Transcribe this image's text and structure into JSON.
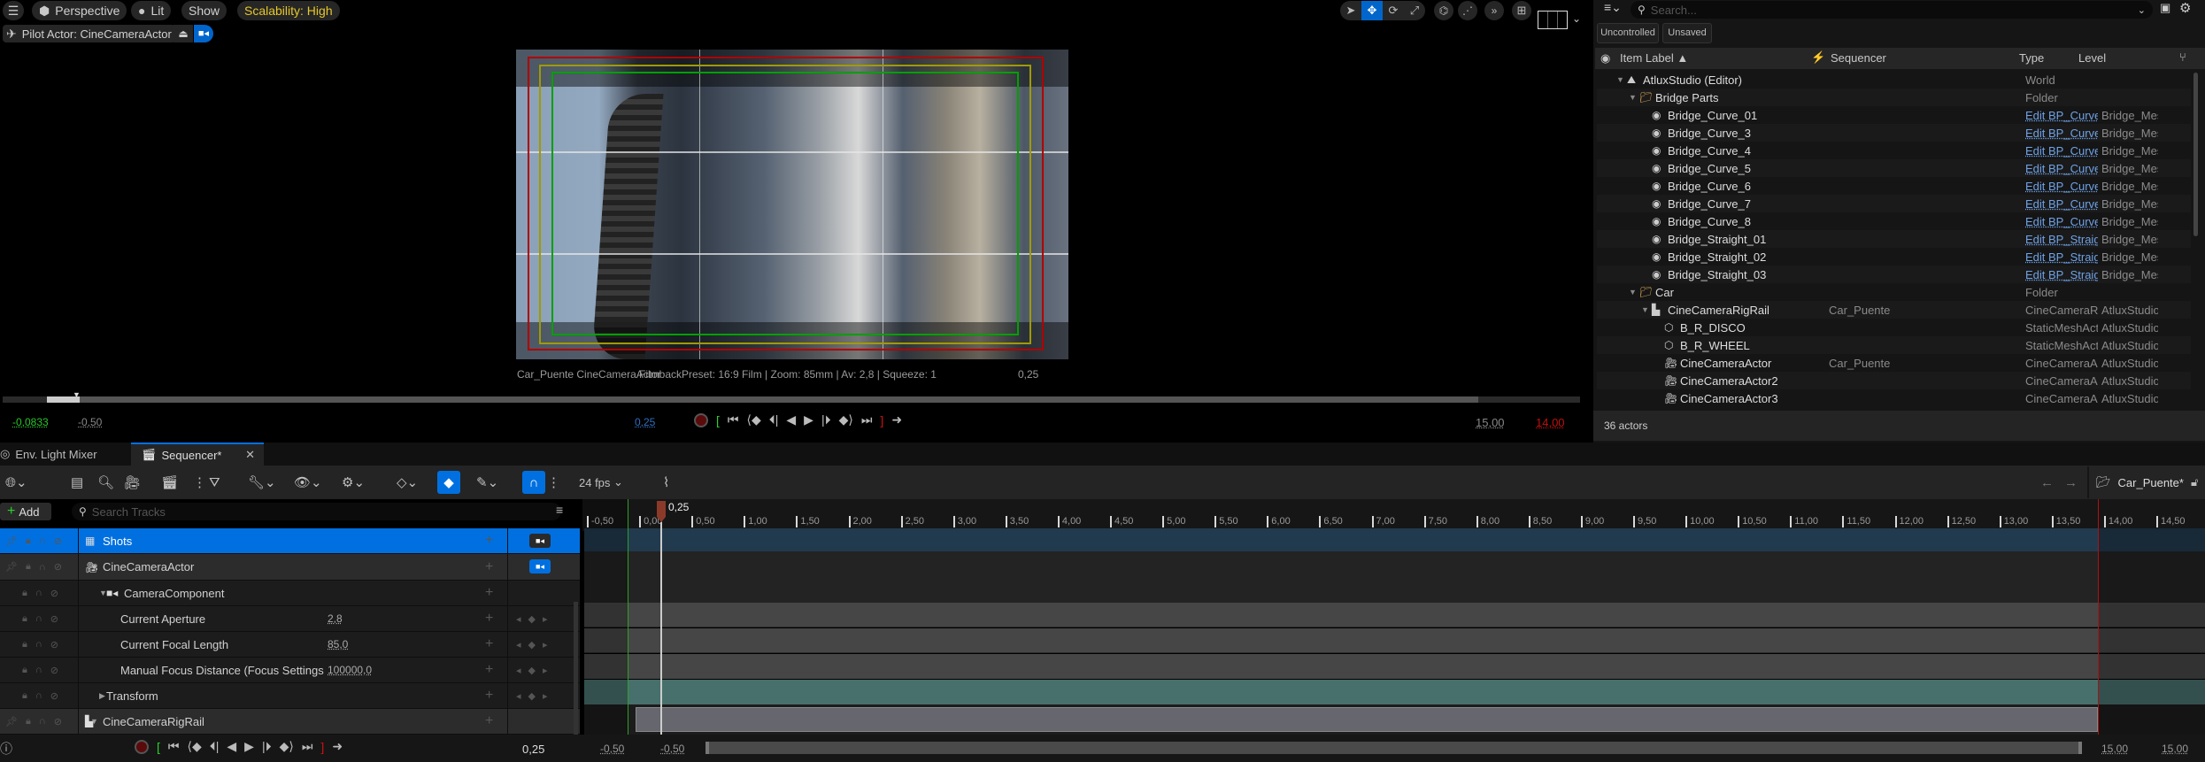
{
  "viewport": {
    "toolbar": {
      "menu_icon": "hamburger-icon",
      "perspective_label": "Perspective",
      "lit_label": "Lit",
      "show_label": "Show",
      "scalability_label": "Scalability: High",
      "pilot_label": "Pilot Actor: CineCameraActor"
    },
    "transform_tools": [
      "select-arrow-icon",
      "translate-icon",
      "rotate-icon",
      "scale-icon",
      "local-space-icon",
      "snap-icon",
      "more-icon",
      "layout-icon"
    ],
    "overlay_left": "Car_Puente  CineCameraActor",
    "overlay_center": "FilmbackPreset: 16:9 Film | Zoom: 85mm | Av: 2,8 | Squeeze: 1",
    "overlay_time": "0,25",
    "playback": {
      "start_time": "-0,0833",
      "view_start": "-0,50",
      "current_time": "0,25",
      "view_end": "15,00",
      "end_time": "14,00"
    }
  },
  "outliner": {
    "search_placeholder": "Search...",
    "filters": [
      "Uncontrolled",
      "Unsaved"
    ],
    "columns": {
      "label": "Item Label ▲",
      "sequencer": "Sequencer",
      "type": "Type",
      "level": "Level"
    },
    "rows": [
      {
        "indent": 1,
        "expander": "▼",
        "icon": "world-icon",
        "label": "AtluxStudio (Editor)",
        "sequencer": "",
        "type": "World",
        "type_link": false,
        "level": ""
      },
      {
        "indent": 2,
        "expander": "▼",
        "icon": "folder-icon",
        "label": "Bridge Parts",
        "sequencer": "",
        "type": "Folder",
        "type_link": false,
        "level": ""
      },
      {
        "indent": 3,
        "expander": "",
        "icon": "actor-icon",
        "label": "Bridge_Curve_01",
        "sequencer": "",
        "type": "Edit BP_Curve",
        "type_link": true,
        "level": "Bridge_Meshes"
      },
      {
        "indent": 3,
        "expander": "",
        "icon": "actor-icon",
        "label": "Bridge_Curve_3",
        "sequencer": "",
        "type": "Edit BP_Curve",
        "type_link": true,
        "level": "Bridge_Meshes"
      },
      {
        "indent": 3,
        "expander": "",
        "icon": "actor-icon",
        "label": "Bridge_Curve_4",
        "sequencer": "",
        "type": "Edit BP_Curve",
        "type_link": true,
        "level": "Bridge_Meshes"
      },
      {
        "indent": 3,
        "expander": "",
        "icon": "actor-icon",
        "label": "Bridge_Curve_5",
        "sequencer": "",
        "type": "Edit BP_Curve",
        "type_link": true,
        "level": "Bridge_Meshes"
      },
      {
        "indent": 3,
        "expander": "",
        "icon": "actor-icon",
        "label": "Bridge_Curve_6",
        "sequencer": "",
        "type": "Edit BP_Curve",
        "type_link": true,
        "level": "Bridge_Meshes"
      },
      {
        "indent": 3,
        "expander": "",
        "icon": "actor-icon",
        "label": "Bridge_Curve_7",
        "sequencer": "",
        "type": "Edit BP_Curve",
        "type_link": true,
        "level": "Bridge_Meshes"
      },
      {
        "indent": 3,
        "expander": "",
        "icon": "actor-icon",
        "label": "Bridge_Curve_8",
        "sequencer": "",
        "type": "Edit BP_Curve",
        "type_link": true,
        "level": "Bridge_Meshes"
      },
      {
        "indent": 3,
        "expander": "",
        "icon": "actor-icon",
        "label": "Bridge_Straight_01",
        "sequencer": "",
        "type": "Edit BP_Straight",
        "type_link": true,
        "level": "Bridge_Meshes"
      },
      {
        "indent": 3,
        "expander": "",
        "icon": "actor-icon",
        "label": "Bridge_Straight_02",
        "sequencer": "",
        "type": "Edit BP_Straight",
        "type_link": true,
        "level": "Bridge_Meshes"
      },
      {
        "indent": 3,
        "expander": "",
        "icon": "actor-icon",
        "label": "Bridge_Straight_03",
        "sequencer": "",
        "type": "Edit BP_Straight",
        "type_link": true,
        "level": "Bridge_Meshes"
      },
      {
        "indent": 2,
        "expander": "▼",
        "icon": "folder-icon",
        "label": "Car",
        "sequencer": "",
        "type": "Folder",
        "type_link": false,
        "level": ""
      },
      {
        "indent": 3,
        "expander": "▼",
        "icon": "rig-rail-icon",
        "label": "CineCameraRigRail",
        "sequencer": "Car_Puente",
        "type": "CineCameraRigRail",
        "type_link": false,
        "level": "AtluxStudio"
      },
      {
        "indent": 4,
        "expander": "",
        "icon": "static-mesh-icon",
        "label": "B_R_DISCO",
        "sequencer": "",
        "type": "StaticMeshActor",
        "type_link": false,
        "level": "AtluxStudio"
      },
      {
        "indent": 4,
        "expander": "",
        "icon": "static-mesh-icon",
        "label": "B_R_WHEEL",
        "sequencer": "",
        "type": "StaticMeshActor",
        "type_link": false,
        "level": "AtluxStudio"
      },
      {
        "indent": 4,
        "expander": "",
        "icon": "cine-camera-icon",
        "label": "CineCameraActor",
        "sequencer": "Car_Puente",
        "type": "CineCameraActor",
        "type_link": false,
        "level": "AtluxStudio"
      },
      {
        "indent": 4,
        "expander": "",
        "icon": "cine-camera-icon",
        "label": "CineCameraActor2",
        "sequencer": "",
        "type": "CineCameraActor",
        "type_link": false,
        "level": "AtluxStudio"
      },
      {
        "indent": 4,
        "expander": "",
        "icon": "cine-camera-icon",
        "label": "CineCameraActor3",
        "sequencer": "",
        "type": "CineCameraActor",
        "type_link": false,
        "level": "AtluxStudio"
      }
    ],
    "actor_count": "36 actors"
  },
  "tabs": [
    {
      "label": "Env. Light Mixer",
      "active": false
    },
    {
      "label": "Sequencer*",
      "active": true
    }
  ],
  "sequencer": {
    "fps": "24 fps",
    "add_label": "Add",
    "search_placeholder": "Search Tracks",
    "sequence_name": "Car_Puente*",
    "playhead_time": "0,25",
    "tracks": [
      {
        "name": "Shots",
        "indent": 0,
        "expander": "",
        "icon": "shots-icon",
        "value": "",
        "selected": true,
        "camera_toggle": "dark",
        "keys": false
      },
      {
        "name": "CineCameraActor",
        "indent": 0,
        "expander": "▼",
        "icon": "cine-camera-icon",
        "value": "",
        "selected": false,
        "camera_toggle": "blue",
        "keys": false
      },
      {
        "name": "CameraComponent",
        "indent": 1,
        "expander": "▼",
        "icon": "camera-component-icon",
        "value": "",
        "selected": false,
        "camera_toggle": "",
        "keys": false
      },
      {
        "name": "Current Aperture",
        "indent": 2,
        "expander": "",
        "icon": "",
        "value": "2,8",
        "selected": false,
        "camera_toggle": "",
        "keys": true
      },
      {
        "name": "Current Focal Length",
        "indent": 2,
        "expander": "",
        "icon": "",
        "value": "85,0",
        "selected": false,
        "camera_toggle": "",
        "keys": true
      },
      {
        "name": "Manual Focus Distance (Focus Settings",
        "indent": 2,
        "expander": "",
        "icon": "",
        "value": "100000,0",
        "selected": false,
        "camera_toggle": "",
        "keys": true
      },
      {
        "name": "Transform",
        "indent": 1,
        "expander": "▶",
        "icon": "",
        "value": "",
        "selected": false,
        "camera_toggle": "",
        "keys": true
      },
      {
        "name": "CineCameraRigRail",
        "indent": 0,
        "expander": "▼",
        "icon": "rig-rail-icon",
        "value": "",
        "selected": false,
        "camera_toggle": "",
        "keys": false
      }
    ],
    "ruler_ticks": [
      "-0,50",
      "0,00",
      "0,50",
      "1,00",
      "1,50",
      "2,00",
      "2,50",
      "3,00",
      "3,50",
      "4,00",
      "4,50",
      "5,00",
      "5,50",
      "6,00",
      "6,50",
      "7,00",
      "7,50",
      "8,00",
      "8,50",
      "9,00",
      "9,50",
      "10,00",
      "10,50",
      "11,00",
      "11,50",
      "12,00",
      "12,50",
      "13,00",
      "13,50",
      "14,00",
      "14,50"
    ],
    "footer": {
      "current_time": "0,25",
      "range_start_outer": "-0,50",
      "range_start_inner": "-0,50",
      "range_end_inner": "15,00",
      "range_end_outer": "15,00"
    }
  },
  "colors": {
    "accent_blue": "#0070e0",
    "scalability_yellow": "#e6c72a",
    "start_green": "#2bd12b",
    "end_red": "#d01010",
    "playhead": "#8b3a2a"
  }
}
